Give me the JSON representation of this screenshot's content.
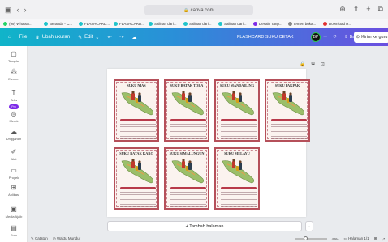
{
  "browser": {
    "address": "canva.com",
    "tabs": [
      {
        "label": "(99) WhatsA...",
        "color": "#25d366"
      },
      {
        "label": "Beranda - C...",
        "color": "#20c4cb"
      },
      {
        "label": "FLASHCARD...",
        "color": "#20c4cb"
      },
      {
        "label": "FLASHCARD...",
        "color": "#20c4cb"
      },
      {
        "label": "Salinan dari...",
        "color": "#20c4cb"
      },
      {
        "label": "Salinan dari...",
        "color": "#20c4cb"
      },
      {
        "label": "Salinan dari...",
        "color": "#20c4cb"
      },
      {
        "label": "Desain Tanp...",
        "color": "#7d2ae8"
      },
      {
        "label": "temen buka...",
        "color": "#888888"
      },
      {
        "label": "Download R...",
        "color": "#e03131"
      }
    ]
  },
  "toolbar": {
    "file": "File",
    "resize": "Ubah ukuran",
    "edit": "Edit",
    "doc_title": "FLASHCARD SUKU CETAK",
    "avatar": "BP",
    "share": "Bagikan",
    "send": "Kirim ke guru"
  },
  "sidebar": {
    "items": [
      {
        "label": "Templat",
        "icon": "template-icon"
      },
      {
        "label": "Elemen",
        "icon": "elements-icon"
      },
      {
        "label": "Teks",
        "icon": "text-icon"
      },
      {
        "label": "Merek",
        "icon": "brand-icon",
        "badge": "Pro"
      },
      {
        "label": "Unggahan",
        "icon": "upload-icon"
      },
      {
        "label": "Alat",
        "icon": "draw-icon"
      },
      {
        "label": "Proyek",
        "icon": "folder-icon"
      },
      {
        "label": "Aplikasi",
        "icon": "apps-icon"
      },
      {
        "label": "Media Ajaib",
        "icon": "magic-media-icon"
      },
      {
        "label": "Foto",
        "icon": "photo-icon"
      }
    ]
  },
  "cards": [
    {
      "title": "SUKU NIAS"
    },
    {
      "title": "SUKU BATAK TOBA"
    },
    {
      "title": "SUKU MANDAILING"
    },
    {
      "title": "SUKU PAKPAK"
    },
    {
      "title": "SUKU BATAK KARO"
    },
    {
      "title": "SUKU SIMALUNGUN"
    },
    {
      "title": "SUKU MELAYU"
    }
  ],
  "canvas": {
    "add_page": "+ Tambah halaman"
  },
  "footer": {
    "notes": "Catatan",
    "timer": "Waktu Mundur",
    "zoom": "49%",
    "pages": "Halaman",
    "page_count": "1/1",
    "zoom_level": 0.35
  }
}
